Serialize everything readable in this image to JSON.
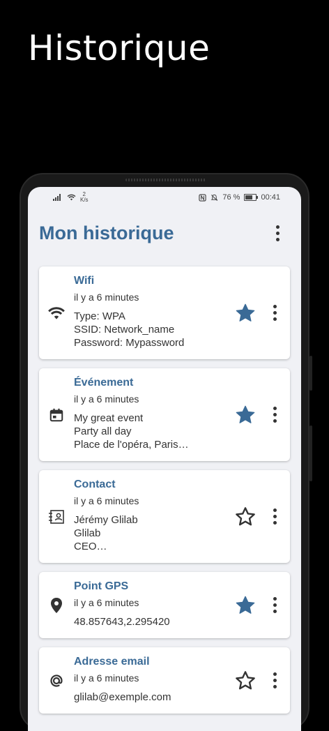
{
  "promo": {
    "title": "Historique"
  },
  "status_bar": {
    "speed_value": "2",
    "speed_unit": "K/s",
    "battery": "76 %",
    "time": "00:41"
  },
  "app_bar": {
    "title": "Mon historique"
  },
  "colors": {
    "accent": "#3a6a96",
    "background": "#f0f1f5",
    "card": "#ffffff"
  },
  "history": [
    {
      "title": "Wifi",
      "time": "il y a 6 minutes",
      "icon": "wifi-icon",
      "favorite": true,
      "lines": [
        "Type: WPA",
        "SSID: Network_name",
        "Password: Mypassword"
      ]
    },
    {
      "title": "Événement",
      "time": "il y a 6 minutes",
      "icon": "calendar-icon",
      "favorite": true,
      "lines": [
        "My great event",
        "Party all day",
        "Place de l'opéra, Paris…"
      ]
    },
    {
      "title": "Contact",
      "time": "il y a 6 minutes",
      "icon": "contact-card-icon",
      "favorite": false,
      "lines": [
        "Jérémy Glilab",
        "Glilab",
        "CEO…"
      ]
    },
    {
      "title": "Point GPS",
      "time": "il y a 6 minutes",
      "icon": "location-pin-icon",
      "favorite": true,
      "lines": [
        "48.857643,2.295420"
      ]
    },
    {
      "title": "Adresse email",
      "time": "il y a 6 minutes",
      "icon": "at-sign-icon",
      "favorite": false,
      "lines": [
        "glilab@exemple.com"
      ]
    }
  ]
}
